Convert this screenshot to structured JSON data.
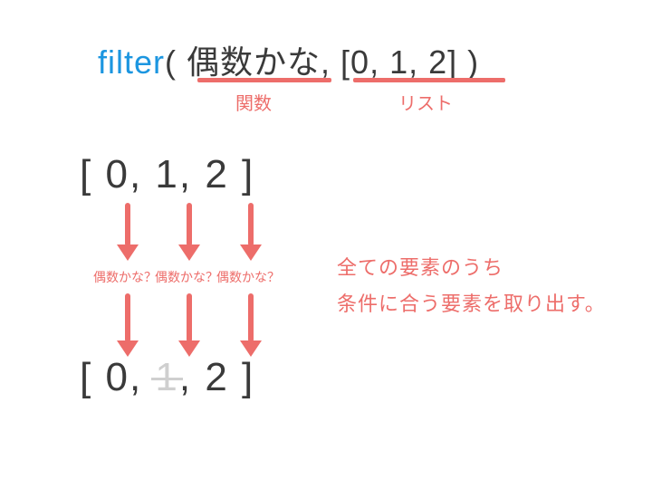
{
  "signature": {
    "fn": "filter",
    "open": "( ",
    "arg1": "偶数かな",
    "comma": ", ",
    "arg2": "[0, 1, 2]",
    "close": " )"
  },
  "labels": {
    "func": "関数",
    "list": "リスト"
  },
  "input_list": {
    "open": "[ ",
    "v0": "0",
    "sep": ",  ",
    "v1": "1",
    "v2": "2",
    "close": " ]"
  },
  "questions": {
    "q1": "偶数かな？",
    "q2": "偶数かな？",
    "q3": "偶数かな？"
  },
  "output_list": {
    "open": "[ ",
    "v0": "0",
    "sep": ",  ",
    "v1": "1",
    "v2": "2",
    "close": " ]"
  },
  "explanation": {
    "line1": "全ての要素のうち",
    "line2": "条件に合う要素を取り出す。"
  },
  "colors": {
    "accent": "#ed6d6a",
    "fn": "#1c96e0",
    "text": "#3a3a3a",
    "muted": "#cfcfcf"
  }
}
